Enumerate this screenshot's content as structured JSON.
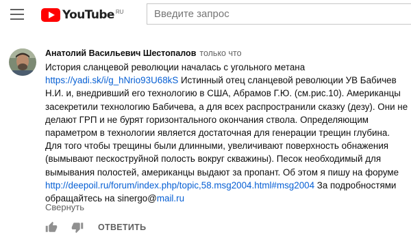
{
  "header": {
    "menu_icon": "hamburger-menu-icon",
    "logo_text": "YouTube",
    "logo_region": "RU",
    "search_placeholder": "Введите запрос"
  },
  "comment": {
    "author": "Анатолий Васильевич Шестопалов",
    "timestamp": "только что",
    "title_line": "История сланцевой революции началась с угольного метана",
    "link1": "https://yadi.sk/i/g_hNrio93U68kS",
    "text_main": " Истинный отец сланцевой революции УВ Бабичев Н.И. и, внедривший его технологию в США, Абрамов Г.Ю. (см.рис.10). Американцы засекретили технологию Бабичева, а для всех распространили сказку (дезу). Они не делают ГРП и не бурят горизонтального окончания ствола. Определяющим параметром в технологии является достаточная для генерации трещин глубина. Для того чтобы трещины были длинными, увеличивают поверхность обнажения (вымывают пескоструйной полость вокруг скважины). Песок необходимый для вымывания полостей, американцы выдают за пропант. Об этом я пишу на форуме ",
    "link2": "http://deepoil.ru/forum/index.php/topic,58.msg2004.html#msg2004",
    "text_tail": "  За подробностями обращайтесь на sinergo@",
    "email_domain": "mail.ru",
    "collapse_label": "Свернуть",
    "reply_label": "ОТВЕТИТЬ",
    "like_icon": "thumb-up-icon",
    "dislike_icon": "thumb-down-icon"
  },
  "colors": {
    "accent_red": "#ff0000",
    "link_blue": "#065fd4",
    "secondary_text": "#606060"
  }
}
